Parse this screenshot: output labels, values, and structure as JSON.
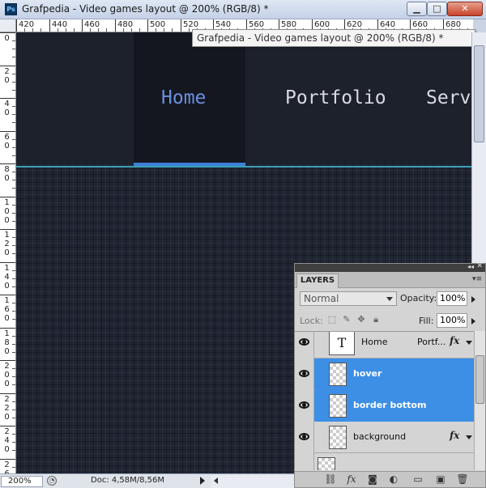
{
  "window": {
    "app_icon_text": "Ps",
    "title": "Grafpedia - Video games layout @ 200% (RGB/8) *",
    "buttons": {
      "minimize": "▁",
      "maximize": "□",
      "close": "✕"
    }
  },
  "tooltip": "Grafpedia - Video games layout @ 200% (RGB/8) *",
  "ruler_h": [
    "420",
    "440",
    "460",
    "480",
    "500",
    "520",
    "540",
    "560",
    "580",
    "600",
    "620",
    "640",
    "660",
    "680"
  ],
  "ruler_v": [
    "0",
    "2 0",
    "4 0",
    "6 0",
    "8 0",
    "1 0 0",
    "1 2 0",
    "1 4 0",
    "1 6 0",
    "1 8 0",
    "2 0 0",
    "2 2 0",
    "2 4 0",
    "2 6"
  ],
  "canvas": {
    "nav_items": [
      "Home",
      "Portfolio",
      "Servi"
    ],
    "active_item": "Home"
  },
  "status": {
    "zoom": "200%",
    "doc": "Doc: 4,58M/8,56M"
  },
  "layers_panel": {
    "tab": "LAYERS",
    "blend_mode": "Normal",
    "opacity_label": "Opacity:",
    "opacity": "100%",
    "lock_label": "Lock:",
    "fill_label": "Fill:",
    "fill": "100%",
    "layers": [
      {
        "name": "Home",
        "extra": "Portf...",
        "type": "text",
        "thumb": "T",
        "fx": "fx",
        "selected": false
      },
      {
        "name": "hover",
        "type": "raster",
        "selected": true
      },
      {
        "name": "border bottom",
        "type": "raster",
        "selected": true
      },
      {
        "name": "background",
        "type": "raster",
        "fx": "fx",
        "selected": false
      }
    ],
    "footer_icons": [
      "link-icon",
      "fx-icon",
      "mask-icon",
      "adjustment-icon",
      "folder-icon",
      "new-layer-icon",
      "trash-icon"
    ]
  },
  "colors": {
    "nav_bg": "#1d212b",
    "hover_bg": "#14171f",
    "active_text": "#6a8fe0",
    "border_bottom": "#3e7fd9",
    "accent_line": "#3aa0b6",
    "selection": "#3d8fe6"
  }
}
